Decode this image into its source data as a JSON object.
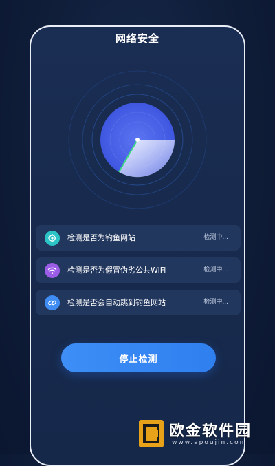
{
  "header": {
    "title": "网络安全"
  },
  "checks": [
    {
      "icon": "shield-icon",
      "icon_color": "#2bc3c6",
      "label": "检测是否为钓鱼网站",
      "status": "检测中..."
    },
    {
      "icon": "wifi-icon",
      "icon_color": "#9b5de5",
      "label": "检测是否为假冒伪劣公共WiFi",
      "status": "检测中..."
    },
    {
      "icon": "link-icon",
      "icon_color": "#3f8cf3",
      "label": "检测是否会自动跳到钓鱼网站",
      "status": "检测中..."
    }
  ],
  "action": {
    "stop_label": "停止检测"
  },
  "watermark": {
    "brand": "欧金软件园",
    "url": "www.apoujin.com"
  },
  "colors": {
    "accent": "#3e8ef6",
    "radar": "#4a63e8",
    "sweep_line": "#3ddc84",
    "card_bg": "#22375e"
  }
}
